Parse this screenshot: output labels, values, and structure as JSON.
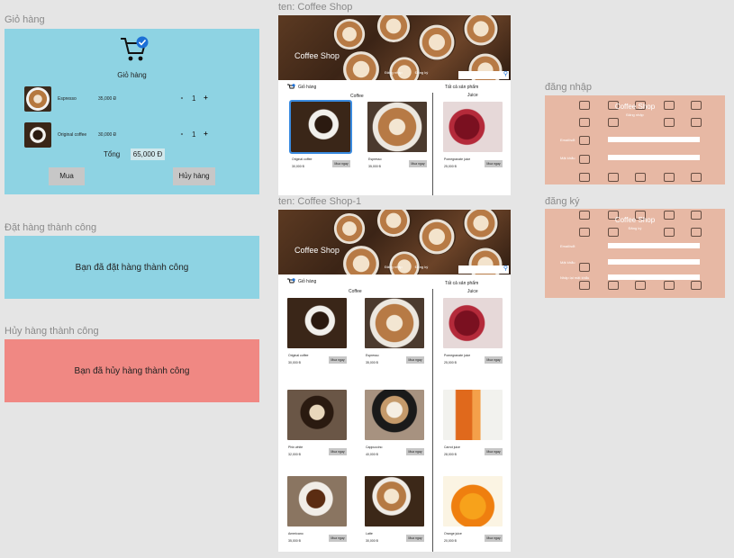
{
  "frames": {
    "cart_title": "Giỏ hàng",
    "order_success_title": "Đặt hàng thành công",
    "cancel_success_title": "Hủy hàng thành công",
    "shop1_title": "ten: Coffee Shop",
    "shop2_title": "ten: Coffee Shop-1",
    "login_title": "đăng nhập",
    "register_title": "đăng ký"
  },
  "cart": {
    "heading": "Giỏ hàng",
    "items": [
      {
        "name": "Espresso",
        "price": "35,000 Đ",
        "qty": "1",
        "minus": "-",
        "plus": "+"
      },
      {
        "name": "Original coffee",
        "price": "30,000 Đ",
        "qty": "1",
        "minus": "-",
        "plus": "+"
      }
    ],
    "total_label": "Tổng",
    "total_value": "65,000 Đ",
    "buy_label": "Mua",
    "cancel_label": "Hủy hàng"
  },
  "messages": {
    "order_success": "Bạn đã đặt hàng thành công",
    "cancel_success": "Bạn đã hủy hàng thành công"
  },
  "shop": {
    "brand": "Coffee Shop",
    "nav": [
      "Đăng nhập",
      "Đăng ký"
    ],
    "cart_tab": "Giỏ hàng",
    "all_products": "Tất cả sản phẩm",
    "coffee_heading": "Coffee",
    "juice_heading": "Juice",
    "buy_now": "Mua ngay",
    "shop1_products": [
      {
        "name": "Original coffee",
        "price": "30,000 Đ"
      },
      {
        "name": "Espresso",
        "price": "35,000 Đ"
      },
      {
        "name": "Pomegranate juice",
        "price": "25,000 Đ"
      }
    ],
    "shop2_products": [
      {
        "name": "Original coffee",
        "price": "30,000 Đ"
      },
      {
        "name": "Espresso",
        "price": "35,000 Đ"
      },
      {
        "name": "Pomegranate juice",
        "price": "25,000 Đ"
      },
      {
        "name": "Phin white",
        "price": "32,000 Đ"
      },
      {
        "name": "Cappuccino",
        "price": "40,000 Đ"
      },
      {
        "name": "Carrot juice",
        "price": "28,000 Đ"
      },
      {
        "name": "Americano",
        "price": "35,000 Đ"
      },
      {
        "name": "Latte",
        "price": "30,000 Đ"
      },
      {
        "name": "Orange juice",
        "price": "20,000 Đ"
      }
    ]
  },
  "login": {
    "brand": "Coffee Shop",
    "subtitle": "Đăng nhập",
    "email_label": "Email/sđt",
    "password_label": "Mật khẩu"
  },
  "register": {
    "brand": "Coffee Shop",
    "subtitle": "Đăng ký",
    "email_label": "Email/sđt",
    "password_label": "Mật khẩu",
    "confirm_label": "Nhập lại mật khẩu"
  },
  "colors": {
    "cart_bg": "#8ed3e3",
    "cancel_bg": "#f08883",
    "auth_bg": "#e7b8a4",
    "selected_outline": "#3a8be0"
  }
}
